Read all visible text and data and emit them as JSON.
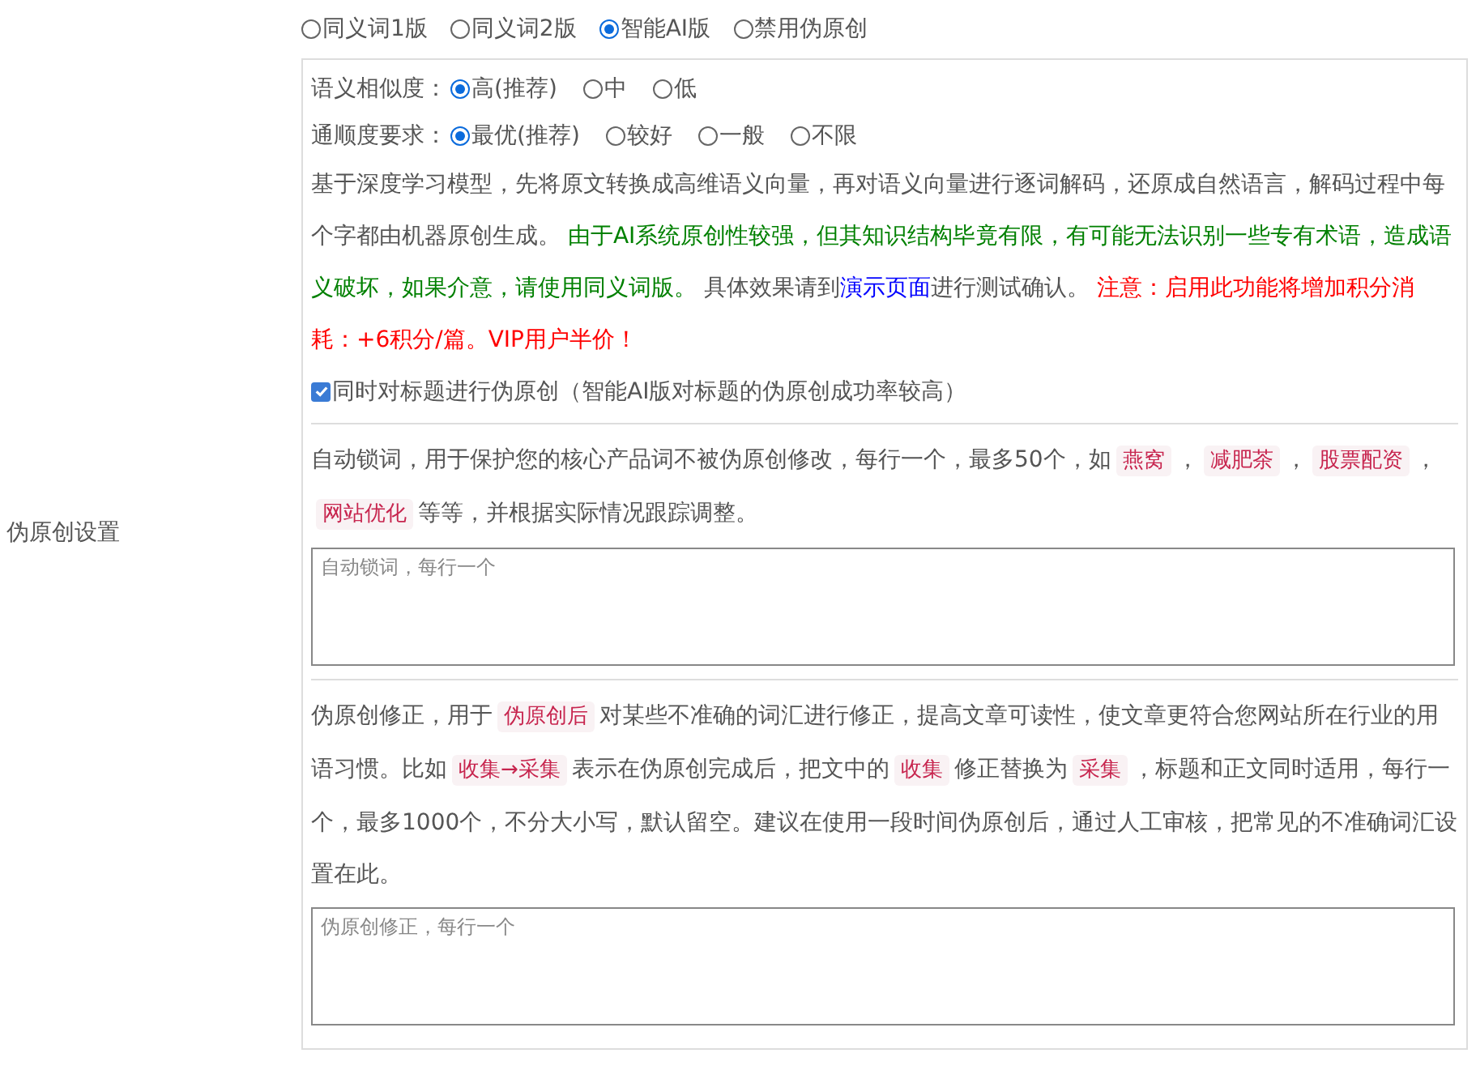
{
  "section_label": "伪原创设置",
  "modes": [
    {
      "label": "同义词1版",
      "selected": false
    },
    {
      "label": "同义词2版",
      "selected": false
    },
    {
      "label": "智能AI版",
      "selected": true
    },
    {
      "label": "禁用伪原创",
      "selected": false
    }
  ],
  "option_groups": [
    {
      "label": "语义相似度：",
      "options": [
        {
          "label": "高(推荐)",
          "selected": true
        },
        {
          "label": "中",
          "selected": false
        },
        {
          "label": "低",
          "selected": false
        }
      ]
    },
    {
      "label": "通顺度要求：",
      "options": [
        {
          "label": "最优(推荐)",
          "selected": true
        },
        {
          "label": "较好",
          "selected": false
        },
        {
          "label": "一般",
          "selected": false
        },
        {
          "label": "不限",
          "selected": false
        }
      ]
    }
  ],
  "description": [
    {
      "kind": "plain",
      "text": "基于深度学习模型，先将原文转换成高维语义向量，再对语义向量进行逐词解码，还原成自然语言，解码过程中每个字都由机器原创生成。 "
    },
    {
      "kind": "green",
      "text": "由于AI系统原创性较强，但其知识结构毕竟有限，有可能无法识别一些专有术语，造成语义破坏，如果介意，请使用同义词版。"
    },
    {
      "kind": "plain",
      "text": " 具体效果请到"
    },
    {
      "kind": "link",
      "text": "演示页面"
    },
    {
      "kind": "plain",
      "text": "进行测试确认。 "
    },
    {
      "kind": "red",
      "text": "注意：启用此功能将增加积分消耗：+6积分/篇。VIP用户半价！"
    }
  ],
  "title_rewrite": {
    "label": "同时对标题进行伪原创（智能AI版对标题的伪原创成功率较高）",
    "checked": true
  },
  "lock_words": {
    "description": [
      {
        "kind": "plain",
        "text": "自动锁词，用于保护您的核心产品词不被伪原创修改，每行一个，最多50个，如"
      },
      {
        "kind": "code",
        "text": "燕窝"
      },
      {
        "kind": "plain",
        "text": "，"
      },
      {
        "kind": "code",
        "text": "减肥茶"
      },
      {
        "kind": "plain",
        "text": "，"
      },
      {
        "kind": "code",
        "text": "股票配资"
      },
      {
        "kind": "plain",
        "text": "，"
      },
      {
        "kind": "code",
        "text": "网站优化"
      },
      {
        "kind": "plain",
        "text": "等等，并根据实际情况跟踪调整。"
      }
    ],
    "placeholder": "自动锁词，每行一个"
  },
  "corrections": {
    "description": [
      {
        "kind": "plain",
        "text": "伪原创修正，用于"
      },
      {
        "kind": "code",
        "text": "伪原创后"
      },
      {
        "kind": "plain",
        "text": "对某些不准确的词汇进行修正，提高文章可读性，使文章更符合您网站所在行业的用语习惯。比如"
      },
      {
        "kind": "code",
        "text": "收集→采集"
      },
      {
        "kind": "plain",
        "text": "表示在伪原创完成后，把文中的"
      },
      {
        "kind": "code",
        "text": "收集"
      },
      {
        "kind": "plain",
        "text": "修正替换为"
      },
      {
        "kind": "code",
        "text": "采集"
      },
      {
        "kind": "plain",
        "text": "，标题和正文同时适用，每行一个，最多1000个，不分大小写，默认留空。建议在使用一段时间伪原创后，通过人工审核，把常见的不准确词汇设置在此。"
      }
    ],
    "placeholder": "伪原创修正，每行一个"
  }
}
